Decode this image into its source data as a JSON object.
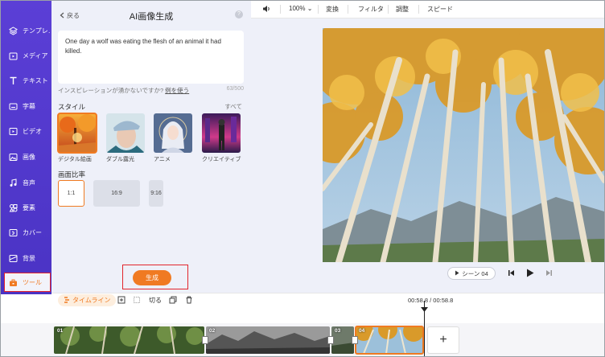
{
  "nav": {
    "items": [
      {
        "label": "テンプレ…",
        "icon": "template-icon"
      },
      {
        "label": "メディア",
        "icon": "media-folder-icon"
      },
      {
        "label": "テキスト",
        "icon": "text-icon"
      },
      {
        "label": "字幕",
        "icon": "subtitle-icon"
      },
      {
        "label": "ビデオ",
        "icon": "video-icon"
      },
      {
        "label": "画像",
        "icon": "image-icon"
      },
      {
        "label": "音声",
        "icon": "audio-icon"
      },
      {
        "label": "要素",
        "icon": "elements-icon"
      },
      {
        "label": "カバー",
        "icon": "cover-icon"
      },
      {
        "label": "背景",
        "icon": "background-icon"
      },
      {
        "label": "ツール",
        "icon": "toolbox-icon",
        "active": true
      }
    ]
  },
  "panel": {
    "back_label": "戻る",
    "title": "AI画像生成",
    "prompt_text": "One day a wolf was eating the flesh of an animal it had killed.",
    "inspiration_text": "インスピレーションが湧かないですか?",
    "example_link": "例を使う",
    "char_count": "63/500",
    "style_label": "スタイル",
    "all_link": "すべて",
    "styles": [
      {
        "name": "デジタル絵画",
        "selected": true
      },
      {
        "name": "ダブル露光",
        "selected": false
      },
      {
        "name": "アニメ",
        "selected": false
      },
      {
        "name": "クリエイティブ",
        "selected": false
      }
    ],
    "ratio_label": "画面比率",
    "ratios": [
      {
        "label": "1:1",
        "selected": true
      },
      {
        "label": "16:9",
        "selected": false
      },
      {
        "label": "9:16",
        "selected": false
      }
    ],
    "generate_label": "生成"
  },
  "toolbar": {
    "zoom": "100%",
    "transform": "変換",
    "filter": "フィルタ",
    "adjust": "調整",
    "speed": "スピード"
  },
  "preview": {
    "scene_label": "シーン 04"
  },
  "timeline": {
    "tab_label": "タイムライン",
    "cut_label": "切る",
    "time_display": "00:58.8 / 00:58.8",
    "clips": [
      {
        "num": "01"
      },
      {
        "num": "02"
      },
      {
        "num": "03"
      },
      {
        "num": "04",
        "selected": true
      }
    ],
    "add_label": "+"
  },
  "colors": {
    "nav_bg": "#5b3fd6",
    "accent": "#f07a22",
    "highlight_box": "#e2242b",
    "panel_bg": "#eef0f9"
  }
}
